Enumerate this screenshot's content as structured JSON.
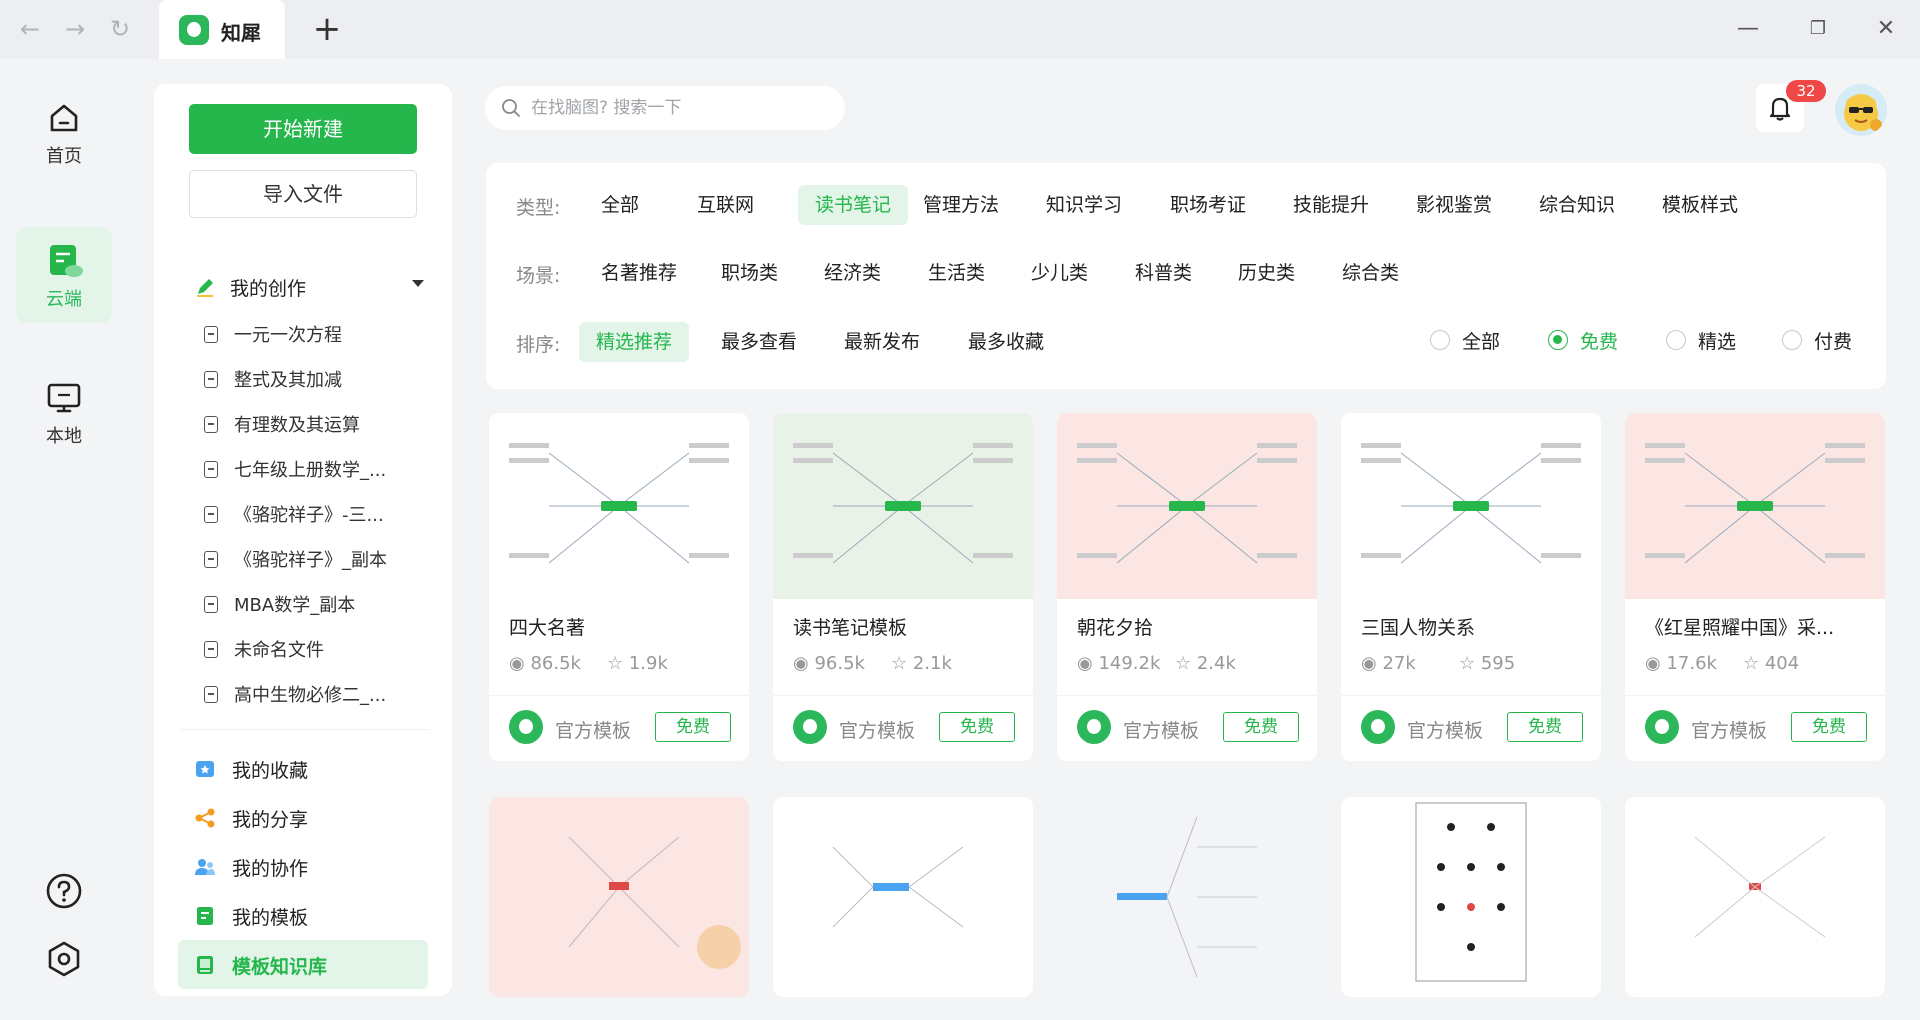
{
  "window": {
    "tab_title": "知犀",
    "new_tab": "+",
    "minimize": "—",
    "maximize": "❐",
    "close": "✕",
    "back": "←",
    "forward": "→",
    "refresh": "↻"
  },
  "rail": {
    "items": [
      {
        "label": "首页",
        "icon": "home-icon"
      },
      {
        "label": "云端",
        "icon": "cloud-doc-icon",
        "active": true
      },
      {
        "label": "本地",
        "icon": "monitor-icon"
      }
    ],
    "bottom": [
      "help-icon",
      "settings-icon"
    ]
  },
  "sidebar": {
    "new_button": "开始新建",
    "import_button": "导入文件",
    "section_title": "我的创作",
    "files": [
      "一元一次方程",
      "整式及其加减",
      "有理数及其运算",
      "七年级上册数学_...",
      "《骆驼祥子》-三...",
      "《骆驼祥子》_副本",
      "MBA数学_副本",
      "未命名文件",
      "高中生物必修二_..."
    ],
    "menu": [
      {
        "label": "我的收藏",
        "icon": "favorites-icon"
      },
      {
        "label": "我的分享",
        "icon": "share-icon"
      },
      {
        "label": "我的协作",
        "icon": "collaborate-icon"
      },
      {
        "label": "我的模板",
        "icon": "template-icon"
      },
      {
        "label": "模板知识库",
        "icon": "library-icon",
        "active": true
      }
    ]
  },
  "search": {
    "placeholder": "在找脑图? 搜索一下"
  },
  "notifications": {
    "count": "32"
  },
  "filters": {
    "type_label": "类型:",
    "types": [
      "全部",
      "互联网",
      "读书笔记",
      "管理方法",
      "知识学习",
      "职场考证",
      "技能提升",
      "影视鉴赏",
      "综合知识",
      "模板样式"
    ],
    "type_active": 2,
    "scene_label": "场景:",
    "scenes": [
      "名著推荐",
      "职场类",
      "经济类",
      "生活类",
      "少儿类",
      "科普类",
      "历史类",
      "综合类"
    ],
    "sort_label": "排序:",
    "sorts": [
      "精选推荐",
      "最多查看",
      "最新发布",
      "最多收藏"
    ],
    "sort_active": 0,
    "price_options": [
      "全部",
      "免费",
      "精选",
      "付费"
    ],
    "price_selected": 1
  },
  "cards": [
    {
      "title": "四大名著",
      "views": "86.5k",
      "stars": "1.9k",
      "author": "官方模板",
      "tag": "免费",
      "bg": "#ffffff"
    },
    {
      "title": "读书笔记模板",
      "views": "96.5k",
      "stars": "2.1k",
      "author": "官方模板",
      "tag": "免费",
      "bg": "#e8f2e6"
    },
    {
      "title": "朝花夕拾",
      "views": "149.2k",
      "stars": "2.4k",
      "author": "官方模板",
      "tag": "免费",
      "bg": "#fbe6e4"
    },
    {
      "title": "三国人物关系",
      "views": "27k",
      "stars": "595",
      "author": "官方模板",
      "tag": "免费",
      "bg": "#ffffff"
    },
    {
      "title": "《红星照耀中国》采...",
      "views": "17.6k",
      "stars": "404",
      "author": "官方模板",
      "tag": "免费",
      "bg": "#fbe6e4"
    }
  ],
  "colors": {
    "brand": "#25b64c",
    "brand_light": "#e2f5e8",
    "badge": "#f04747"
  }
}
